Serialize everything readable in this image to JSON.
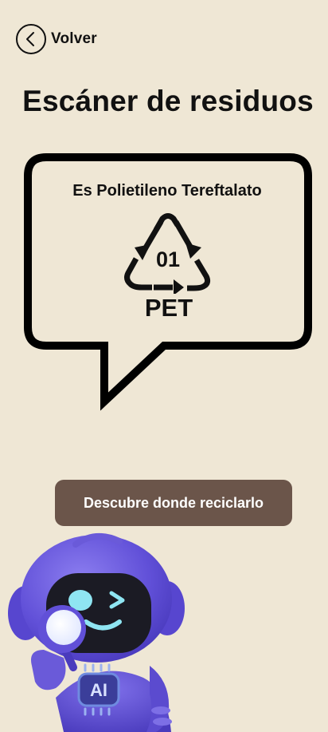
{
  "header": {
    "back_label": "Volver"
  },
  "page": {
    "title": "Escáner de residuos"
  },
  "result": {
    "material_name": "Es Polietileno Tereftalato",
    "resin_code": "01",
    "resin_abbreviation": "PET",
    "symbol": "recycle-triangle-icon"
  },
  "actions": {
    "cta_label": "Descubre donde reciclarlo"
  },
  "mascot": {
    "badge_text": "AI",
    "icon": "robot-mascot-icon"
  },
  "colors": {
    "background": "#efe7d5",
    "button": "#6b554a",
    "button_text": "#ffffff",
    "ink": "#111111",
    "robot_primary": "#6c5ce0"
  }
}
